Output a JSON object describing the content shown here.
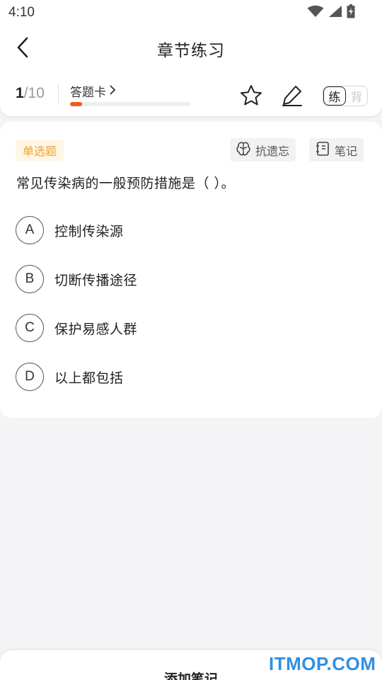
{
  "status_bar": {
    "time": "4:10",
    "icons": [
      "wifi-icon",
      "cellular-signal-icon",
      "battery-charging-icon"
    ]
  },
  "header": {
    "title": "章节练习",
    "back_icon": "chevron-left-icon"
  },
  "progress": {
    "current": "1",
    "separator_total": "/10",
    "answer_card_label": "答题卡",
    "answer_card_icon": "chevron-right-icon",
    "progress_fraction": 0.1,
    "progress_color": "#f05a1e",
    "favorite_icon": "star-icon",
    "edit_icon": "pen-icon",
    "modes": [
      "练",
      "背"
    ],
    "active_mode": "练"
  },
  "question": {
    "type_label": "单选题",
    "memory_button": "抗遗忘",
    "memory_icon": "brain-icon",
    "notes_button": "笔记",
    "notes_icon": "notebook-icon",
    "text": "常见传染病的一般预防措施是（   ）。",
    "options": [
      {
        "letter": "A",
        "text": "控制传染源"
      },
      {
        "letter": "B",
        "text": "切断传播途径"
      },
      {
        "letter": "C",
        "text": "保护易感人群"
      },
      {
        "letter": "D",
        "text": "以上都包括"
      }
    ]
  },
  "bottom_sheet": {
    "title": "添加笔记"
  },
  "watermark": "ITMOP.COM",
  "colors": {
    "accent": "#f05a1e",
    "badge_text": "#f2a324",
    "badge_bg": "#fff6e7",
    "watermark": "#2f8fe6"
  }
}
